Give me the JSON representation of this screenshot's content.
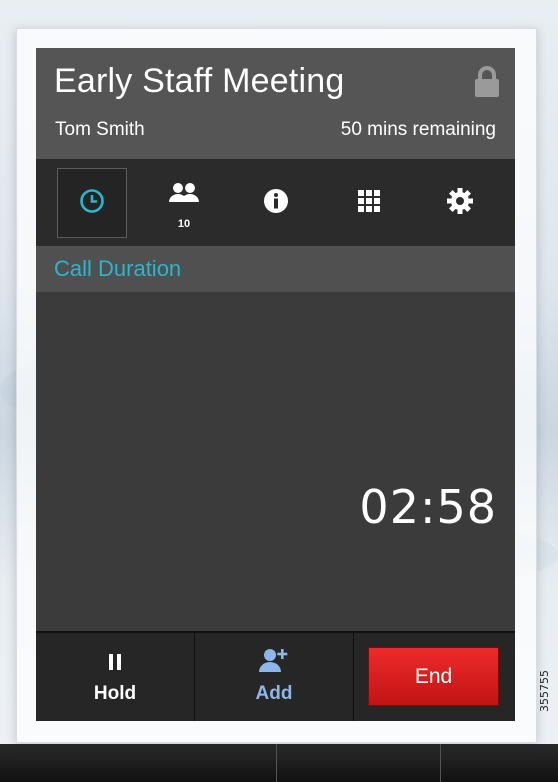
{
  "meeting": {
    "title": "Early Staff Meeting",
    "participant": "Tom Smith",
    "time_remaining": "50 mins remaining"
  },
  "tabs": [
    {
      "icon": "clock-icon",
      "active": true
    },
    {
      "icon": "participants-icon",
      "count": "10"
    },
    {
      "icon": "info-icon"
    },
    {
      "icon": "keypad-icon"
    },
    {
      "icon": "gear-icon"
    }
  ],
  "section": {
    "label": "Call Duration"
  },
  "call": {
    "duration": "02:58"
  },
  "toolbar": {
    "hold_label": "Hold",
    "add_label": "Add",
    "end_label": "End"
  },
  "colors": {
    "accent": "#2ab6cf",
    "end": "#e01b1b",
    "add": "#8fb6e8"
  },
  "figure_number": "355755"
}
